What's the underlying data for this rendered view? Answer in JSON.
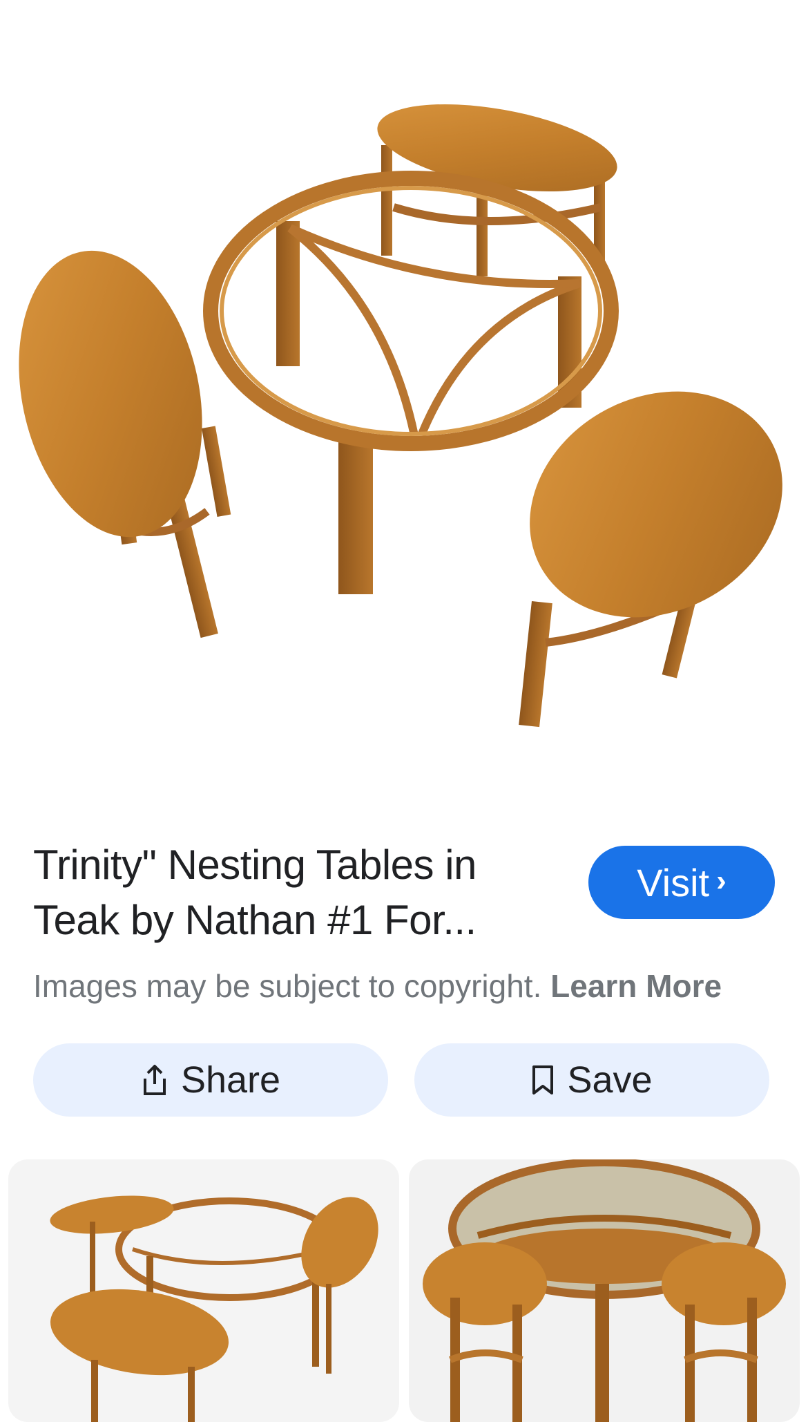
{
  "result": {
    "title": "Trinity\" Nesting Tables in Teak by Nathan #1 For...",
    "visit_label": "Visit",
    "visit_chevron": "›",
    "copyright_text": "Images may be subject to copyright.",
    "learn_more_label": "Learn More"
  },
  "actions": {
    "share_label": "Share",
    "save_label": "Save"
  },
  "icons": {
    "share": "share-icon",
    "save": "bookmark-icon",
    "chevron": "chevron-right-icon"
  },
  "colors": {
    "accent": "#1a73e8",
    "action_bg": "#e8f0fe",
    "teak": "#c8832f",
    "teak_dark": "#9c5e1e",
    "muted_text": "#70757a"
  }
}
